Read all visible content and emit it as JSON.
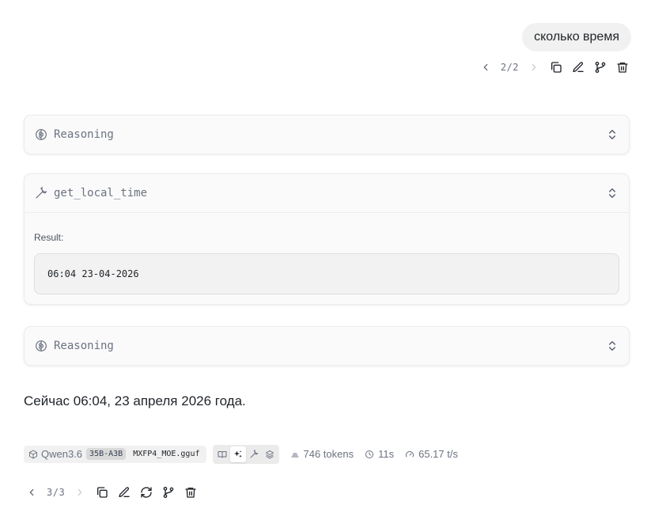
{
  "user_message": {
    "text": "сколько время",
    "pager": "2/2"
  },
  "reasoning_1": {
    "title": "Reasoning"
  },
  "tool_call": {
    "name": "get_local_time",
    "result_label": "Result:",
    "result_value": "06:04 23-04-2026"
  },
  "reasoning_2": {
    "title": "Reasoning"
  },
  "assistant_message": {
    "text": "Сейчас 06:04, 23 апреля 2026 года.",
    "pager": "3/3"
  },
  "stats": {
    "model_name": "Qwen3.6",
    "model_badge": "35B-A3B",
    "model_file": "MXFP4_MOE.gguf",
    "tokens": "746 tokens",
    "duration": "11s",
    "speed": "65.17 t/s"
  },
  "icons": {
    "prev": "chevron-left-icon",
    "next": "chevron-right-icon",
    "copy": "copy-icon",
    "edit": "edit-icon",
    "branch": "branch-icon",
    "delete": "trash-icon",
    "regenerate": "refresh-icon",
    "reasoning": "brain-icon",
    "tool": "wrench-icon",
    "expand": "chevrons-up-down-icon"
  },
  "colors": {
    "text": "#1f2328",
    "muted": "#6b7280",
    "card_bg": "#fafafa",
    "bubble_bg": "#f1f1f1"
  }
}
